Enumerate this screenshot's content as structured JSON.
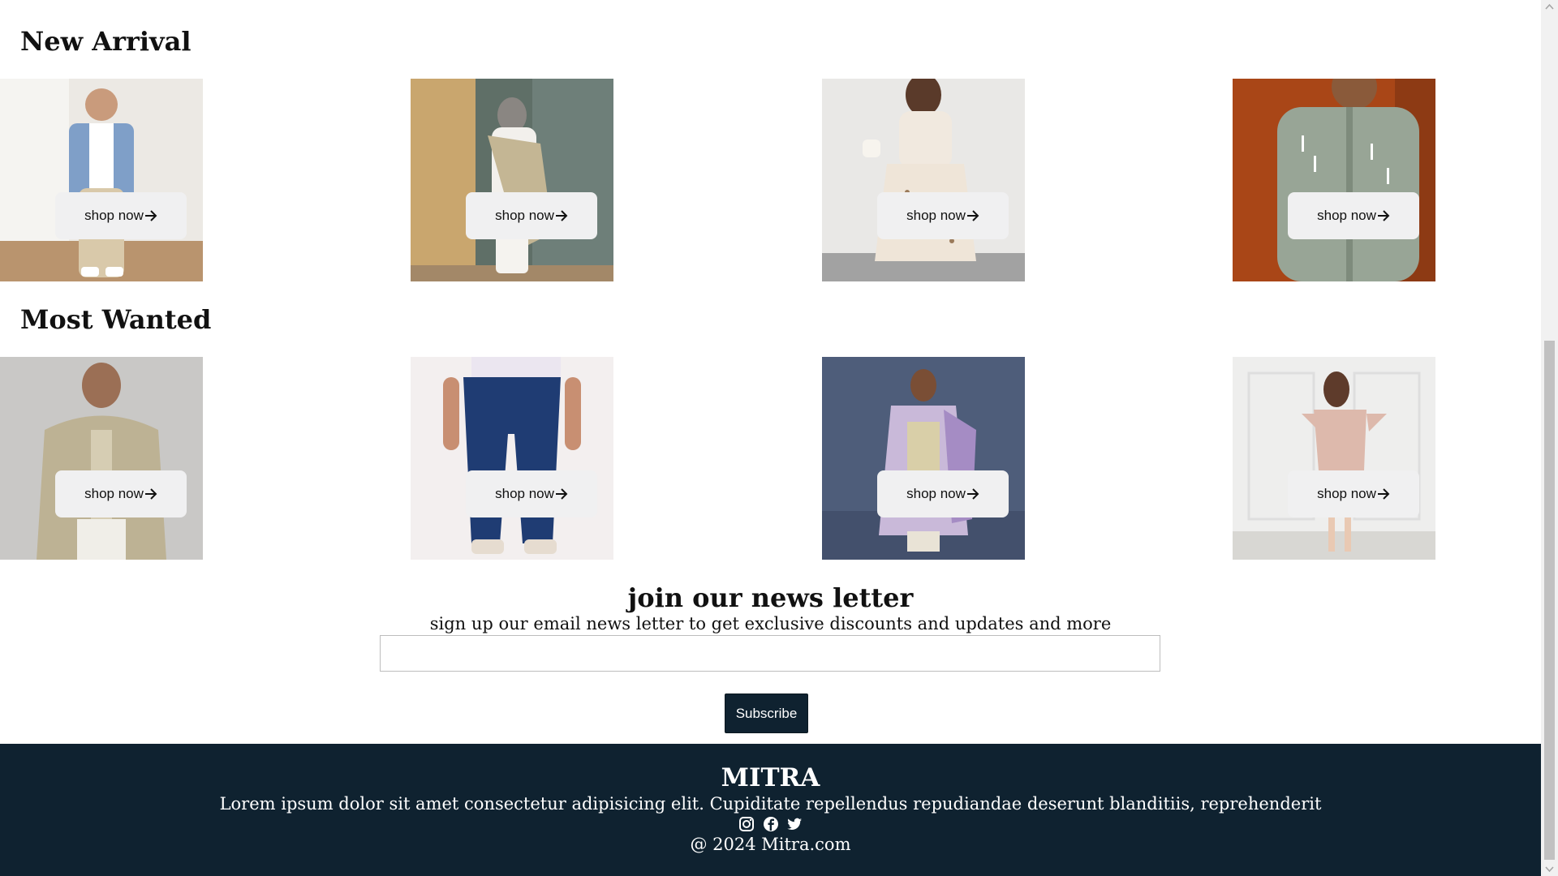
{
  "sections": [
    {
      "title": "New Arrival",
      "products": [
        {
          "image": "man in blue denim shirt and beige chinos",
          "cta": "shop now"
        },
        {
          "image": "woman in white outfit with grey hijab and dupatta",
          "cta": "shop now"
        },
        {
          "image": "woman in floral puff-sleeve dress",
          "cta": "shop now"
        },
        {
          "image": "man in sage green embroidered kurta",
          "cta": "shop now"
        }
      ]
    },
    {
      "title": "Most Wanted",
      "products": [
        {
          "image": "man in beige sherwani",
          "cta": "shop now"
        },
        {
          "image": "man in dark blue jeans and white tee",
          "cta": "shop now"
        },
        {
          "image": "woman in lavender embroidered suit",
          "cta": "shop now"
        },
        {
          "image": "woman in pink bodycon dress",
          "cta": "shop now"
        }
      ]
    }
  ],
  "newsletter": {
    "title": "join our news letter",
    "subtitle": "sign up our email news letter to get exclusive discounts and updates and more",
    "input_value": "",
    "input_placeholder": "",
    "button_label": "Subscribe"
  },
  "footer": {
    "brand": "MITRA",
    "text": "Lorem ipsum dolor sit amet consectetur adipisicing elit. Cupiditate repellendus repudiandae deserunt blanditiis, reprehenderit",
    "icons": [
      "instagram-icon",
      "facebook-icon",
      "twitter-icon"
    ],
    "copyright": "@ 2024 Mitra.com"
  },
  "colors": {
    "footer_bg": "#0f2230",
    "button_bg": "#f0f0f1",
    "subscribe_bg": "#0f2230"
  }
}
